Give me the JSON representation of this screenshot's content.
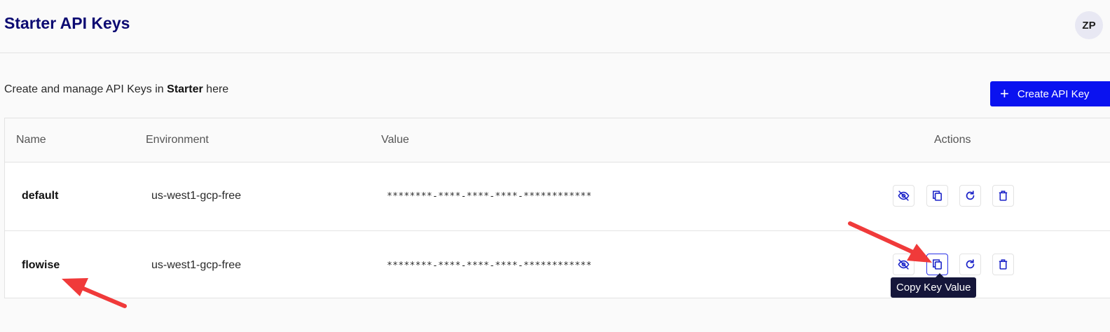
{
  "header": {
    "title": "Starter API Keys",
    "avatar_initials": "ZP"
  },
  "intro": {
    "prefix": "Create and manage API Keys in ",
    "project": "Starter",
    "suffix": " here"
  },
  "create_button": {
    "label": "Create API Key",
    "icon": "plus-icon"
  },
  "table": {
    "columns": [
      "Name",
      "Environment",
      "Value",
      "Actions"
    ],
    "rows": [
      {
        "name": "default",
        "environment": "us-west1-gcp-free",
        "value": "********-****-****-****-************"
      },
      {
        "name": "flowise",
        "environment": "us-west1-gcp-free",
        "value": "********-****-****-****-************"
      }
    ],
    "actions": [
      "eye-off-icon",
      "copy-icon",
      "refresh-icon",
      "trash-icon"
    ]
  },
  "tooltip": {
    "text": "Copy Key Value"
  },
  "colors": {
    "accent": "#0a12f0",
    "title": "#0c0a72",
    "annotation": "#f03a3a"
  }
}
